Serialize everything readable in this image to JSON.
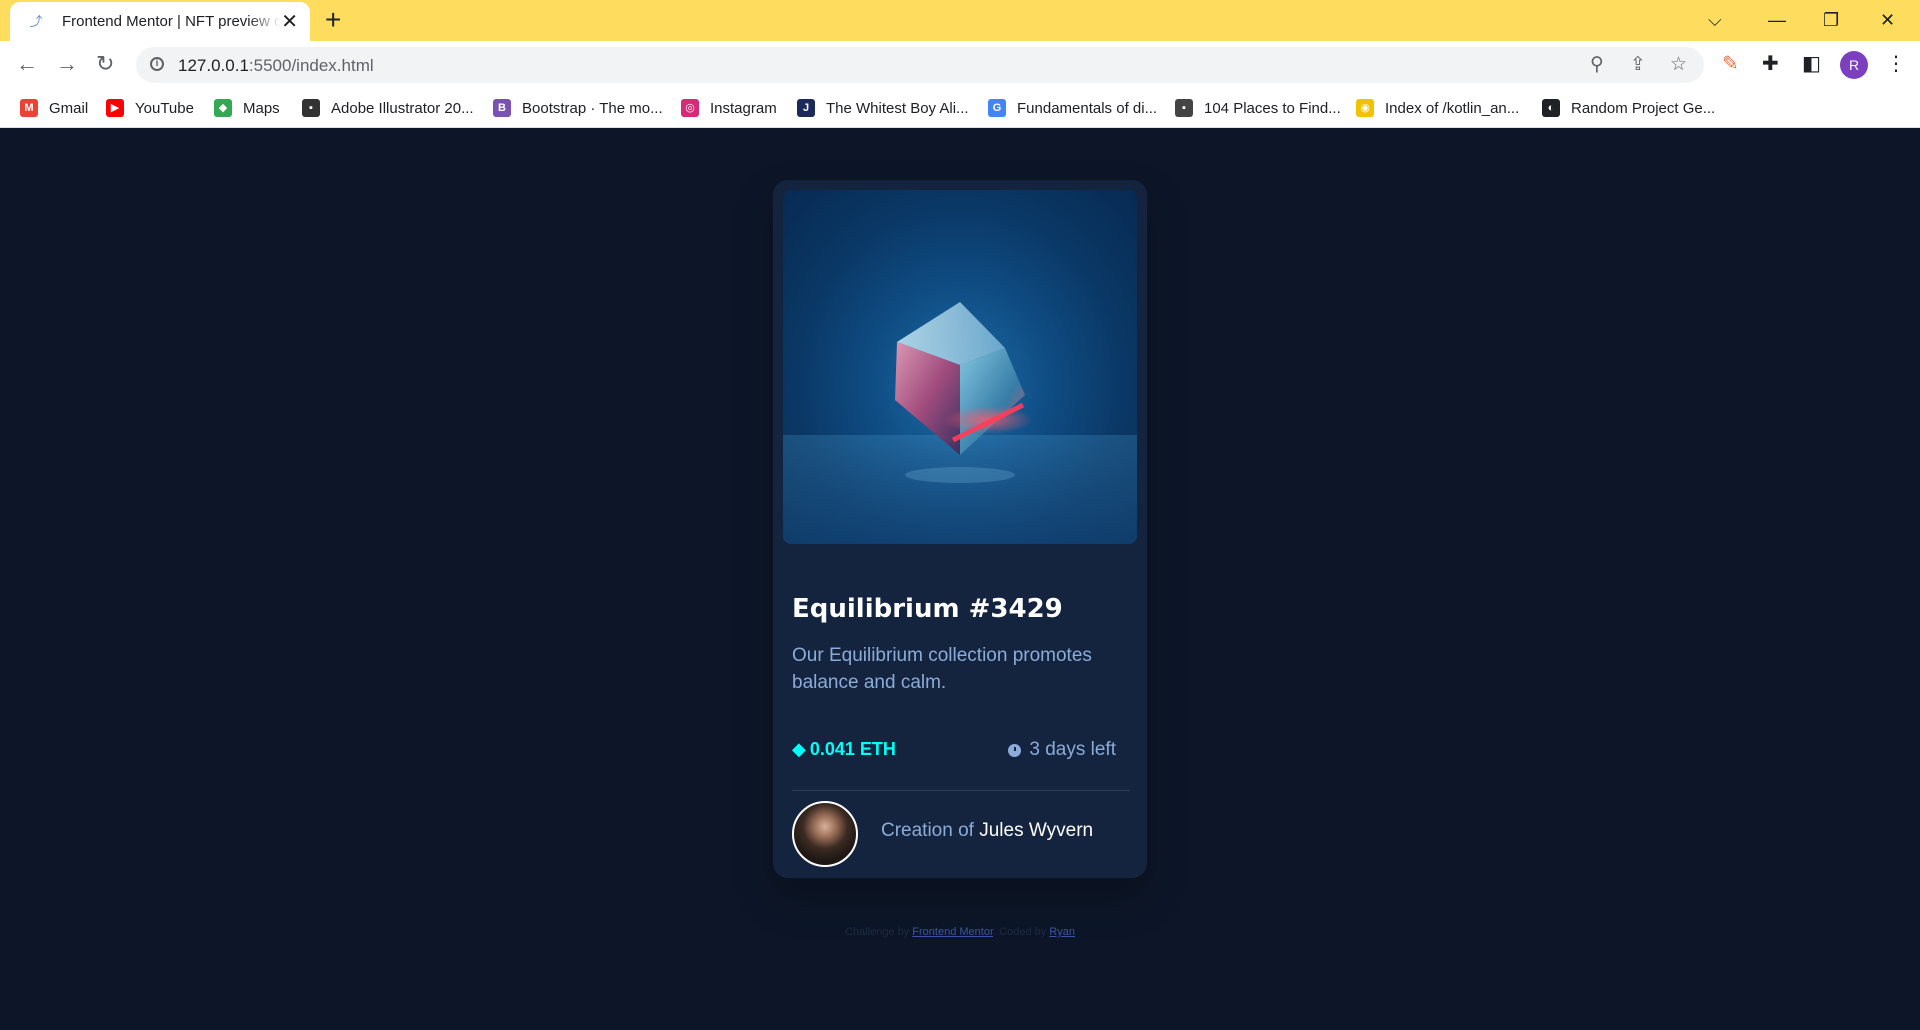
{
  "browser": {
    "tab": {
      "title": "Frontend Mentor | NFT preview card component"
    },
    "url": {
      "host": "127.0.0.1",
      "rest": ":5500/index.html"
    },
    "profile_initial": "R",
    "bookmarks": [
      {
        "label": "Gmail",
        "icon": "gmail-icon",
        "color": "#ea4335",
        "glyph": "M"
      },
      {
        "label": "YouTube",
        "icon": "youtube-icon",
        "color": "#ff0000",
        "glyph": "▶"
      },
      {
        "label": "Maps",
        "icon": "maps-icon",
        "color": "#34a853",
        "glyph": "◆"
      },
      {
        "label": "Adobe Illustrator 20...",
        "icon": "illustrator-icon",
        "color": "#333333",
        "glyph": "▪"
      },
      {
        "label": "Bootstrap · The mo...",
        "icon": "bootstrap-icon",
        "color": "#7952b3",
        "glyph": "B"
      },
      {
        "label": "Instagram",
        "icon": "instagram-icon",
        "color": "#d62976",
        "glyph": "◎"
      },
      {
        "label": "The Whitest Boy Ali...",
        "icon": "bookmark-j-icon",
        "color": "#1b2a5a",
        "glyph": "J"
      },
      {
        "label": "Fundamentals of di...",
        "icon": "google-icon",
        "color": "#4285f4",
        "glyph": "G"
      },
      {
        "label": "104 Places to Find...",
        "icon": "places-icon",
        "color": "#444444",
        "glyph": "▪"
      },
      {
        "label": "Index of /kotlin_an...",
        "icon": "index-icon",
        "color": "#f2c200",
        "glyph": "◉"
      },
      {
        "label": "Random Project Ge...",
        "icon": "globe-icon",
        "color": "#202124",
        "glyph": "◐"
      }
    ]
  },
  "card": {
    "title": "Equilibrium #3429",
    "description": "Our Equilibrium collection promotes balance and calm.",
    "price": "0.041 ETH",
    "time_left": "3 days left",
    "creator_prefix": "Creation of",
    "creator_name": "Jules Wyvern"
  },
  "attribution": {
    "challenge_prefix": "Challenge by",
    "challenge_link": "Frontend Mentor",
    "coded_prefix": ". Coded by",
    "coder_link": "Ryan"
  },
  "colors": {
    "page_bg": "#0d1628",
    "card_bg": "#15243e",
    "accent_cyan": "#00fff8",
    "soft_blue": "#8bacd9",
    "tab_bar": "#fedd5e"
  }
}
